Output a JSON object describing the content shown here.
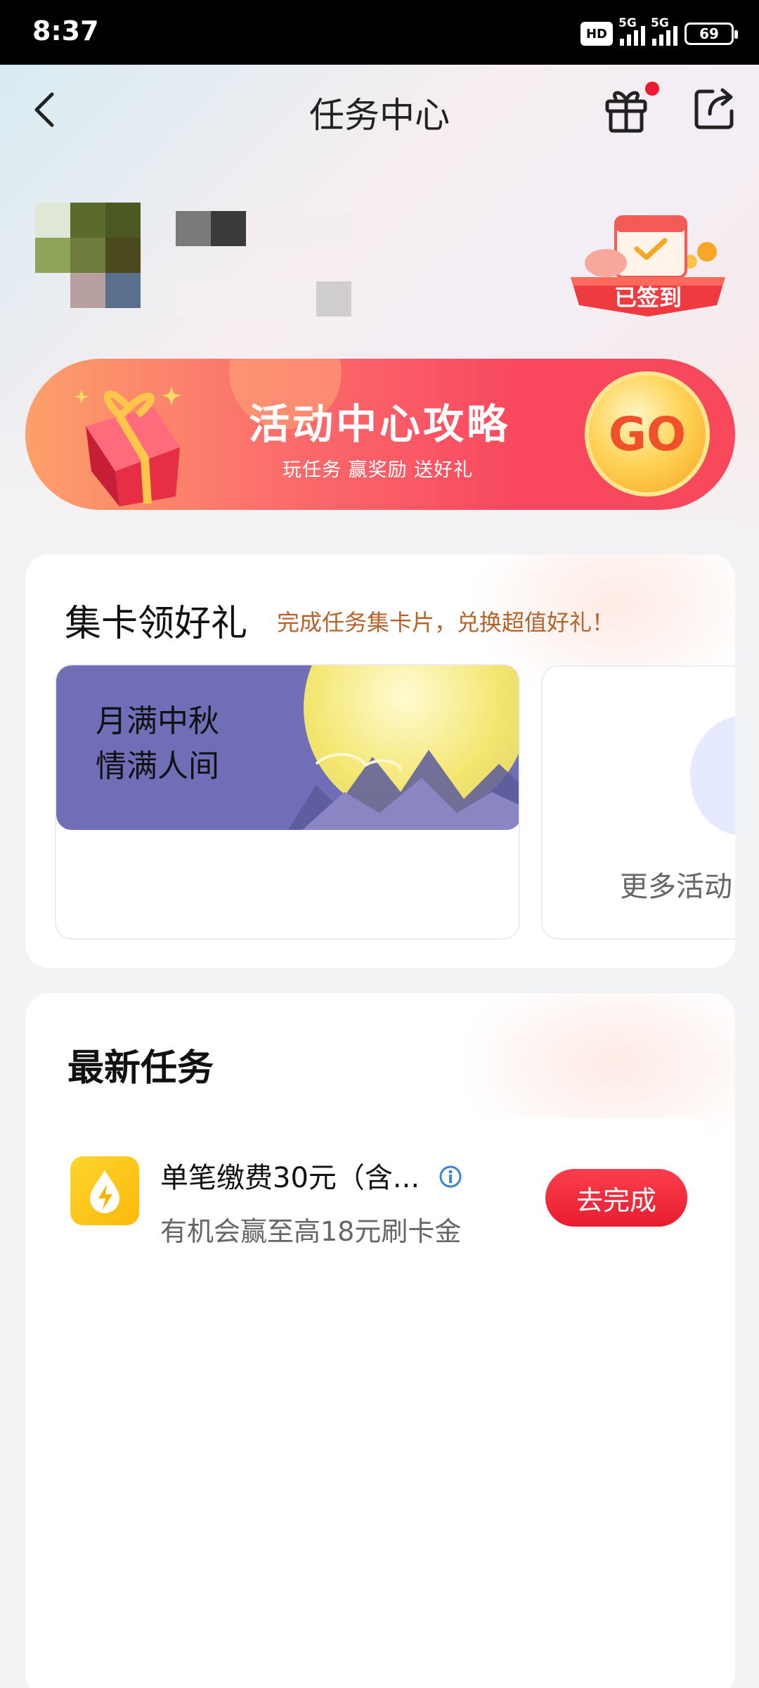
{
  "status_bar": {
    "time": "8:37",
    "hd": "HD",
    "net1": "5G",
    "net2": "5G",
    "battery": "69"
  },
  "header": {
    "title": "任务中心"
  },
  "signin": {
    "label": "已签到"
  },
  "banner": {
    "title": "活动中心攻略",
    "subtitle": "玩任务 赢奖励 送好礼",
    "go": "GO"
  },
  "cards": {
    "title": "集卡领好礼",
    "subtitle": "完成任务集卡片，兑换超值好礼！",
    "activity_line1": "月满中秋",
    "activity_line2": "情满人间",
    "more": "更多活动"
  },
  "tasks": {
    "title": "最新任务",
    "items": [
      {
        "title": "单笔缴费30元（含...",
        "desc": "有机会赢至高18元刷卡金",
        "button": "去完成"
      }
    ]
  }
}
